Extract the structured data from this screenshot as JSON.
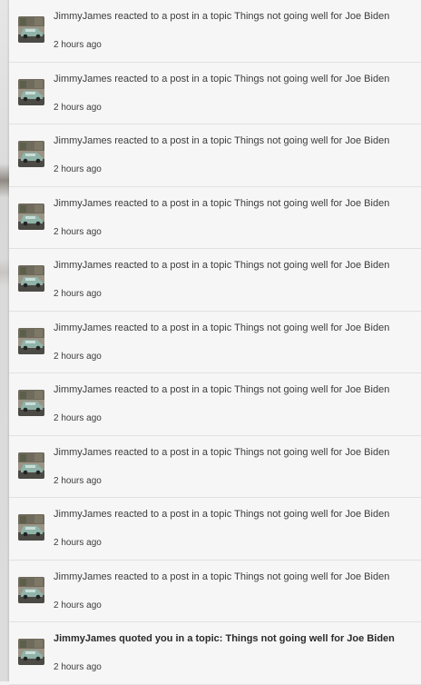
{
  "notifications": [
    {
      "text": "JimmyJames reacted to a post in a topic Things not going well for Joe Biden",
      "time": "2 hours ago",
      "avatar_icon": "car-avatar",
      "bold": false
    },
    {
      "text": "JimmyJames reacted to a post in a topic Things not going well for Joe Biden",
      "time": "2 hours ago",
      "avatar_icon": "car-avatar",
      "bold": false
    },
    {
      "text": "JimmyJames reacted to a post in a topic Things not going well for Joe Biden",
      "time": "2 hours ago",
      "avatar_icon": "car-avatar",
      "bold": false
    },
    {
      "text": "JimmyJames reacted to a post in a topic Things not going well for Joe Biden",
      "time": "2 hours ago",
      "avatar_icon": "car-avatar",
      "bold": false
    },
    {
      "text": "JimmyJames reacted to a post in a topic Things not going well for Joe Biden",
      "time": "2 hours ago",
      "avatar_icon": "car-avatar",
      "bold": false
    },
    {
      "text": "JimmyJames reacted to a post in a topic Things not going well for Joe Biden",
      "time": "2 hours ago",
      "avatar_icon": "car-avatar",
      "bold": false
    },
    {
      "text": "JimmyJames reacted to a post in a topic Things not going well for Joe Biden",
      "time": "2 hours ago",
      "avatar_icon": "car-avatar",
      "bold": false
    },
    {
      "text": "JimmyJames reacted to a post in a topic Things not going well for Joe Biden",
      "time": "2 hours ago",
      "avatar_icon": "car-avatar",
      "bold": false
    },
    {
      "text": "JimmyJames reacted to a post in a topic Things not going well for Joe Biden",
      "time": "2 hours ago",
      "avatar_icon": "car-avatar",
      "bold": false
    },
    {
      "text": "JimmyJames reacted to a post in a topic Things not going well for Joe Biden",
      "time": "2 hours ago",
      "avatar_icon": "car-avatar",
      "bold": false
    },
    {
      "text": "JimmyJames quoted you in a topic: Things not going well for Joe Biden",
      "time": "2 hours ago",
      "avatar_icon": "car-avatar",
      "bold": true
    }
  ]
}
